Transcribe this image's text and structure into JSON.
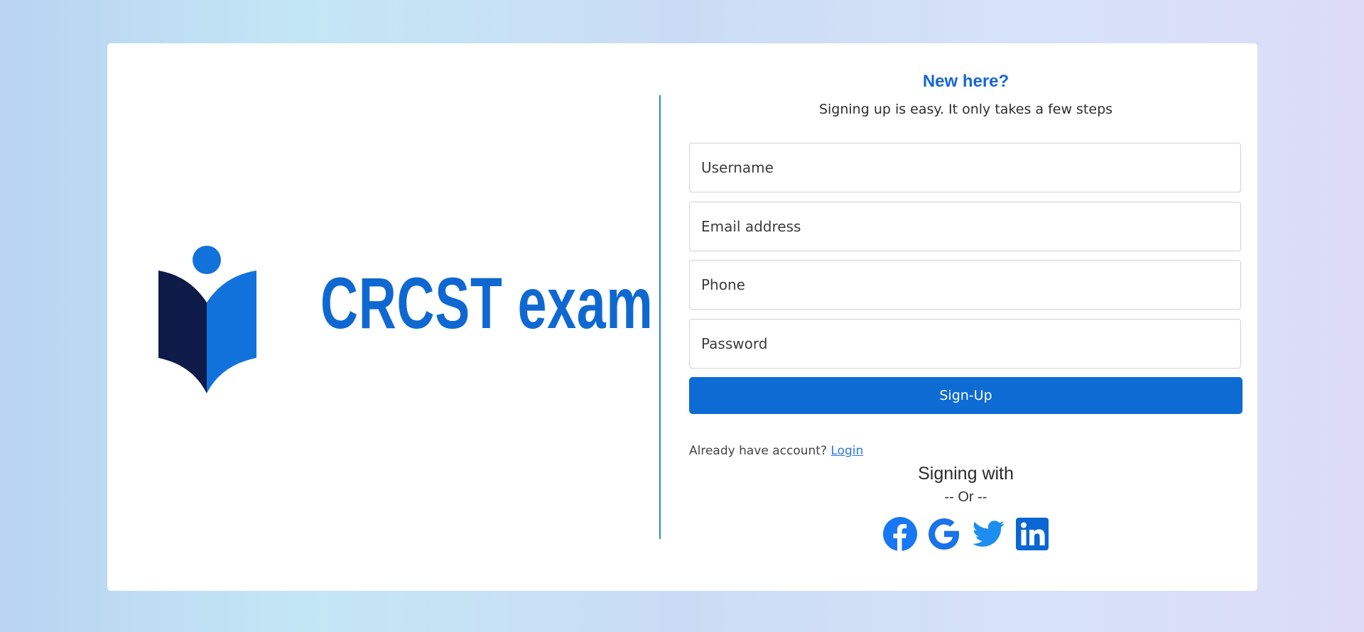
{
  "brand": {
    "logo_text": "CRCST exam",
    "color": "#0f68d2",
    "dark": "#0e1a47"
  },
  "signup": {
    "heading": "New here?",
    "subheading": "Signing up is easy. It only takes a few steps",
    "username_placeholder": "Username",
    "email_placeholder": "Email address",
    "phone_placeholder": "Phone",
    "password_placeholder": "Password",
    "submit_label": "Sign-Up",
    "already_text": "Already have account?",
    "login_link": "Login",
    "signing_with": "Signing with",
    "or_text": "-- Or --",
    "social_icons": [
      "facebook-icon",
      "google-icon",
      "twitter-icon",
      "linkedin-icon"
    ],
    "accent": "#0d6bd4"
  }
}
